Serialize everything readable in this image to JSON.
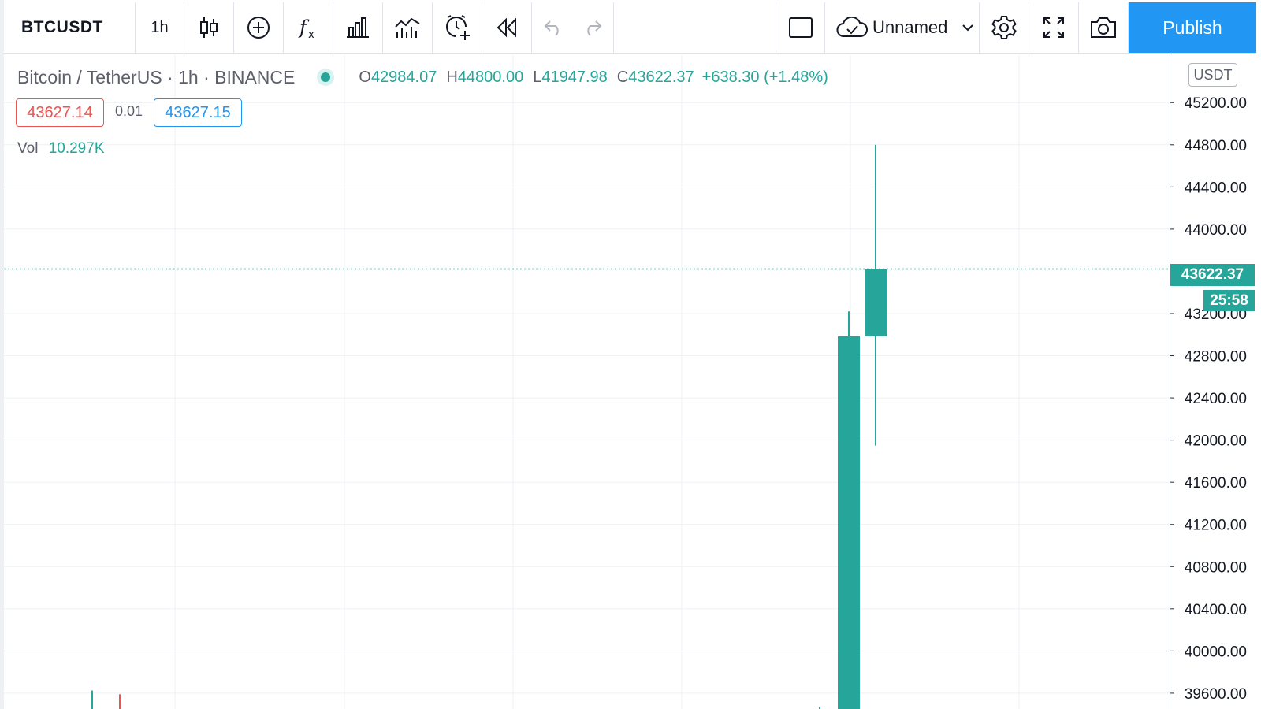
{
  "toolbar": {
    "symbol": "BTCUSDT",
    "interval": "1h",
    "layout_name": "Unnamed",
    "publish_label": "Publish",
    "icons": [
      "bars-style-icon",
      "compare-add-icon",
      "indicators-fx-icon",
      "financials-icon",
      "ideas-chart-icon",
      "alert-icon",
      "replay-icon",
      "undo-icon",
      "redo-icon",
      "layout-select-icon",
      "cloud-save-icon",
      "chevron-down-icon",
      "settings-gear-icon",
      "fullscreen-icon",
      "snapshot-camera-icon"
    ]
  },
  "legend": {
    "description": "Bitcoin / TetherUS · 1h · BINANCE",
    "open_label": "O",
    "open": "42984.07",
    "high_label": "H",
    "high": "44800.00",
    "low_label": "L",
    "low": "41947.98",
    "close_label": "C",
    "close": "43622.37",
    "change": "+638.30 (+1.48%)"
  },
  "quote": {
    "bid": "43627.14",
    "spread": "0.01",
    "ask": "43627.15"
  },
  "volume": {
    "label": "Vol",
    "value": "10.297K"
  },
  "price_axis": {
    "currency": "USDT",
    "last_price": "43622.37",
    "countdown": "25:58"
  },
  "colors": {
    "up": "#26a69a",
    "down": "#ef5350",
    "accent": "#2196f3",
    "grid": "#eef1f5"
  },
  "chart_data": {
    "type": "candlestick",
    "price_ticks": [
      45200,
      44800,
      44400,
      44000,
      43200,
      42800,
      42400,
      42000,
      41600,
      41200,
      40800,
      40400,
      40000,
      39600
    ],
    "price_tick_labels": [
      "45200.00",
      "44800.00",
      "44400.00",
      "44000.00",
      "43200.00",
      "42800.00",
      "42400.00",
      "42000.00",
      "41600.00",
      "41200.00",
      "40800.00",
      "40400.00",
      "40000.00",
      "39600.00"
    ],
    "ylim": [
      39450,
      45650
    ],
    "candles": [
      {
        "open": 39410,
        "high": 39440,
        "low": 39380,
        "close": 39425
      },
      {
        "open": 39415,
        "high": 39625,
        "low": 39380,
        "close": 39430
      },
      {
        "open": 39450,
        "high": 39590,
        "low": 39380,
        "close": 39400
      },
      {
        "open": 39410,
        "high": 39470,
        "low": 39380,
        "close": 39420
      },
      {
        "open": 39300,
        "high": 43220,
        "low": 39250,
        "close": 42984.07
      },
      {
        "open": 42984.07,
        "high": 44800.0,
        "low": 41947.98,
        "close": 43622.37
      }
    ],
    "last_price": 43622.37
  }
}
